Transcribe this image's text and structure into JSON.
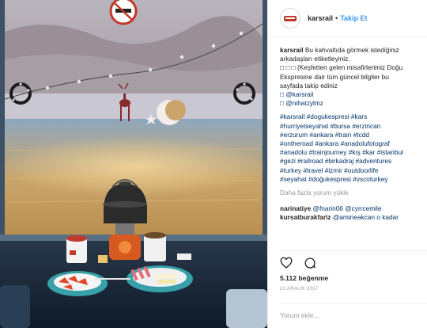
{
  "post": {
    "username": "karsrail",
    "follow_label": "Takip Et",
    "caption_lines": [
      "Bu kahvaltıda görmek istediğiniz",
      "arkadaşları etiketleyiniz.",
      "□ □ □ (Keşfetten gelen misafirlerimiz Doğu",
      "Ekspresine dair tüm güncel bilgiler bu",
      "sayfada takip ediniz",
      "□ @karsrail",
      "□ @nihatzylmz"
    ],
    "hashtag_lines": [
      "#karsrail #dogukespresi #kars",
      "#hurriyetseyahat #bursa #erzincan",
      "#erzurum #ankara #train #tcdd",
      "#ontheroad #ankara #anadolufotograf",
      "#anadolu #trainjourney #kış #kar #istanbul",
      "#gezi #railroad #birkadraj #adventures",
      "#turkey #travel #izmir #outdoorlife",
      "#seyahat #doğukespresi #vscoturkey"
    ],
    "load_more": "Daha fazla yorum yükle",
    "comment1_user": "narinatiye",
    "comment1_text": "@fnarin06 @cyrrcemile",
    "comment2_user": "kursatburakfariz",
    "comment2_text": "@amineakcan o kadar",
    "likes": "5.112 beğenme",
    "date": "22 ARALIK 2017",
    "add_comment_placeholder": "Yorum ekle..."
  },
  "icons": {
    "like": "heart-icon",
    "comment": "comment-icon"
  },
  "colors": {
    "link": "#3897f0",
    "hashtag": "#003569",
    "muted": "#999999"
  }
}
